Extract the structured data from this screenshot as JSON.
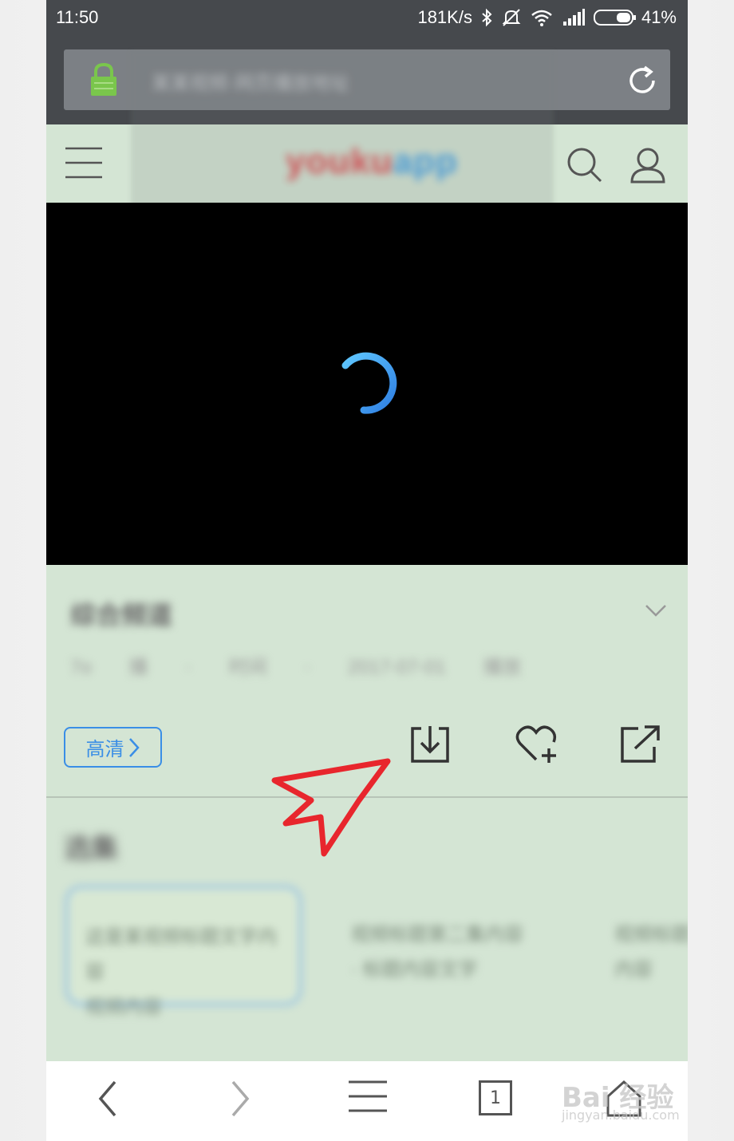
{
  "status_bar": {
    "time": "11:50",
    "network_speed": "181K/s",
    "battery": "41%",
    "icons": [
      "bluetooth-icon",
      "mute-icon",
      "wifi-icon",
      "signal-icon",
      "battery-icon"
    ]
  },
  "url_bar": {
    "url": "某某视频·网页播放地址",
    "icons": [
      "lock-icon",
      "reload-icon"
    ]
  },
  "site_header": {
    "logo_part1": "youku",
    "logo_part2": "app",
    "icons": [
      "menu-icon",
      "search-icon",
      "user-icon"
    ]
  },
  "video": {
    "state": "loading",
    "spinner_color": "#3a9ae8"
  },
  "info": {
    "title": "综合频道",
    "meta": "7o 播 · 时间 · 2017-07-01 播放",
    "icons": [
      "chevron-down-icon"
    ]
  },
  "actions": {
    "quality_label": "高清",
    "quality_color": "#3a8ee6",
    "icons": [
      "download-icon",
      "heart-plus-icon",
      "share-icon"
    ]
  },
  "annotation": {
    "color": "#e8262d",
    "points_to": "download-icon"
  },
  "related": {
    "title": "选集",
    "cards": [
      {
        "line1": "这是某视频标题文字内容",
        "line2": "视频内容"
      },
      {
        "line1": "视频标题第二集内容",
        "line2": "· 标题内容文字"
      },
      {
        "line1": "视频标题",
        "line2": "内容"
      }
    ]
  },
  "bottom_nav": {
    "tab_count": "1",
    "icons": [
      "back-icon",
      "forward-icon",
      "menu-lines-icon",
      "tabs-icon",
      "home-icon"
    ]
  },
  "watermark": {
    "main": "Bai 经验",
    "sub": "jingyan.baidu.com"
  }
}
